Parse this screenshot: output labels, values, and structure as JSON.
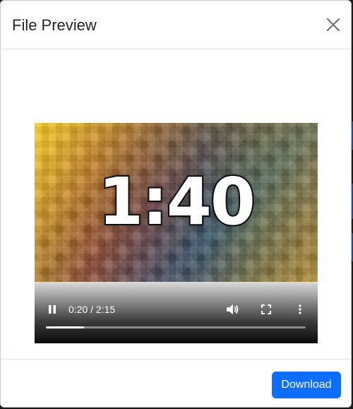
{
  "modal": {
    "title": "File Preview",
    "close_icon": "close-icon"
  },
  "video": {
    "frame_text": "1:40",
    "current_time": "0:20",
    "duration": "2:15",
    "time_display": "0:20 / 2:15",
    "progress_fraction": 0.148,
    "icons": {
      "play_pause": "pause-icon",
      "volume": "volume-icon",
      "fullscreen": "fullscreen-icon",
      "more": "more-vertical-icon"
    }
  },
  "footer": {
    "download_label": "Download"
  },
  "colors": {
    "accent": "#0d6efd",
    "header_border": "#dee2e6",
    "title_text": "#212529"
  }
}
